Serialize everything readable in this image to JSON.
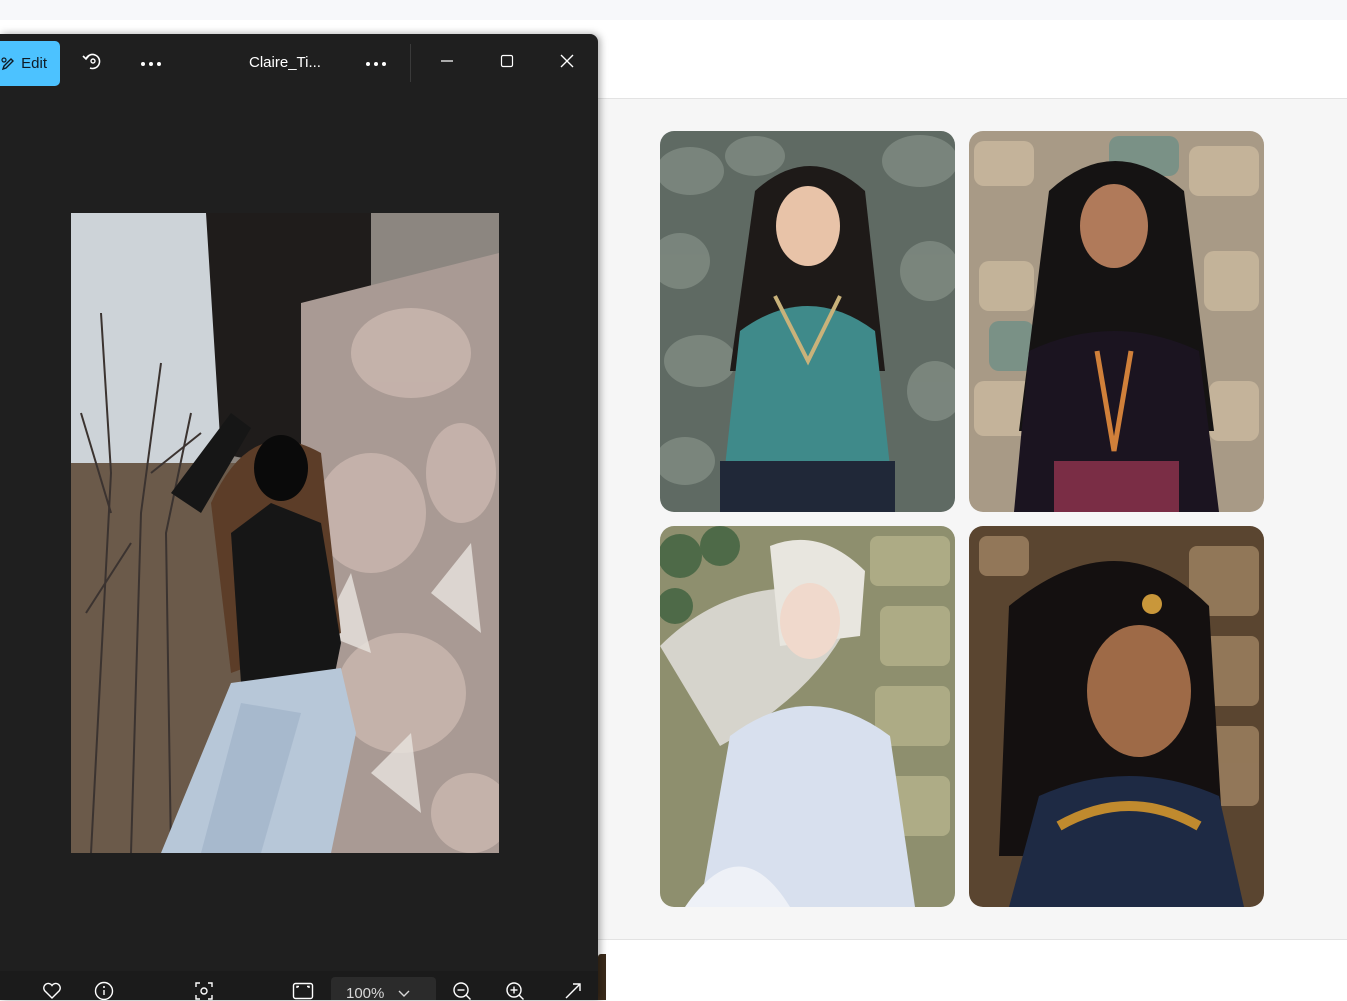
{
  "photos_app": {
    "edit_label": "Edit",
    "file_title": "Claire_Ti...",
    "zoom_level": "100%",
    "accent_color": "#4cc2ff",
    "icons": {
      "rotate": "rotate-icon",
      "more": "more-icon",
      "minimize": "minimize-icon",
      "maximize": "maximize-icon",
      "close": "close-icon",
      "favorite": "heart-icon",
      "info": "info-icon",
      "focus": "focus-icon",
      "fit": "fit-to-window-icon",
      "zoom_out": "zoom-out-icon",
      "zoom_in": "zoom-in-icon",
      "expand": "expand-icon"
    }
  },
  "gallery": {
    "images": [
      {
        "name": "portrait-woman-teal-dress"
      },
      {
        "name": "portrait-woman-dark-dress"
      },
      {
        "name": "portrait-woman-white-dress"
      },
      {
        "name": "portrait-woman-gold-jewelry"
      }
    ]
  }
}
